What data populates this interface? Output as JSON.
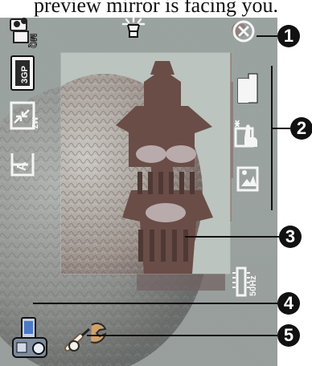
{
  "caption": "preview mirror is facing you.",
  "icons": {
    "video_mode": "video-camera-mq-icon",
    "flash": "flash-lamp-icon",
    "close": "close-circle-x-icon",
    "format": "3gp-film-icon",
    "size": "resize-mz-icon",
    "text_overlay": "text-frame-icon",
    "frame": "frame-card-icon",
    "brightness": "brightness-hand-icon",
    "landscape": "landscape-icon",
    "flicker": "flicker-50hz-icon",
    "device": "device-camera-icon",
    "tools": "tools-wrench-icon"
  },
  "callouts": [
    "1",
    "2",
    "3",
    "4",
    "5"
  ],
  "flicker_label": "50Hz",
  "format_label": "3GP",
  "quality_label": "MQ",
  "colors": {
    "accent": "#111111",
    "icon_white": "#f6f6f6",
    "icon_dark": "#171717",
    "device_blue": "#4b7ac7",
    "tool_orange": "#d2a06a"
  }
}
